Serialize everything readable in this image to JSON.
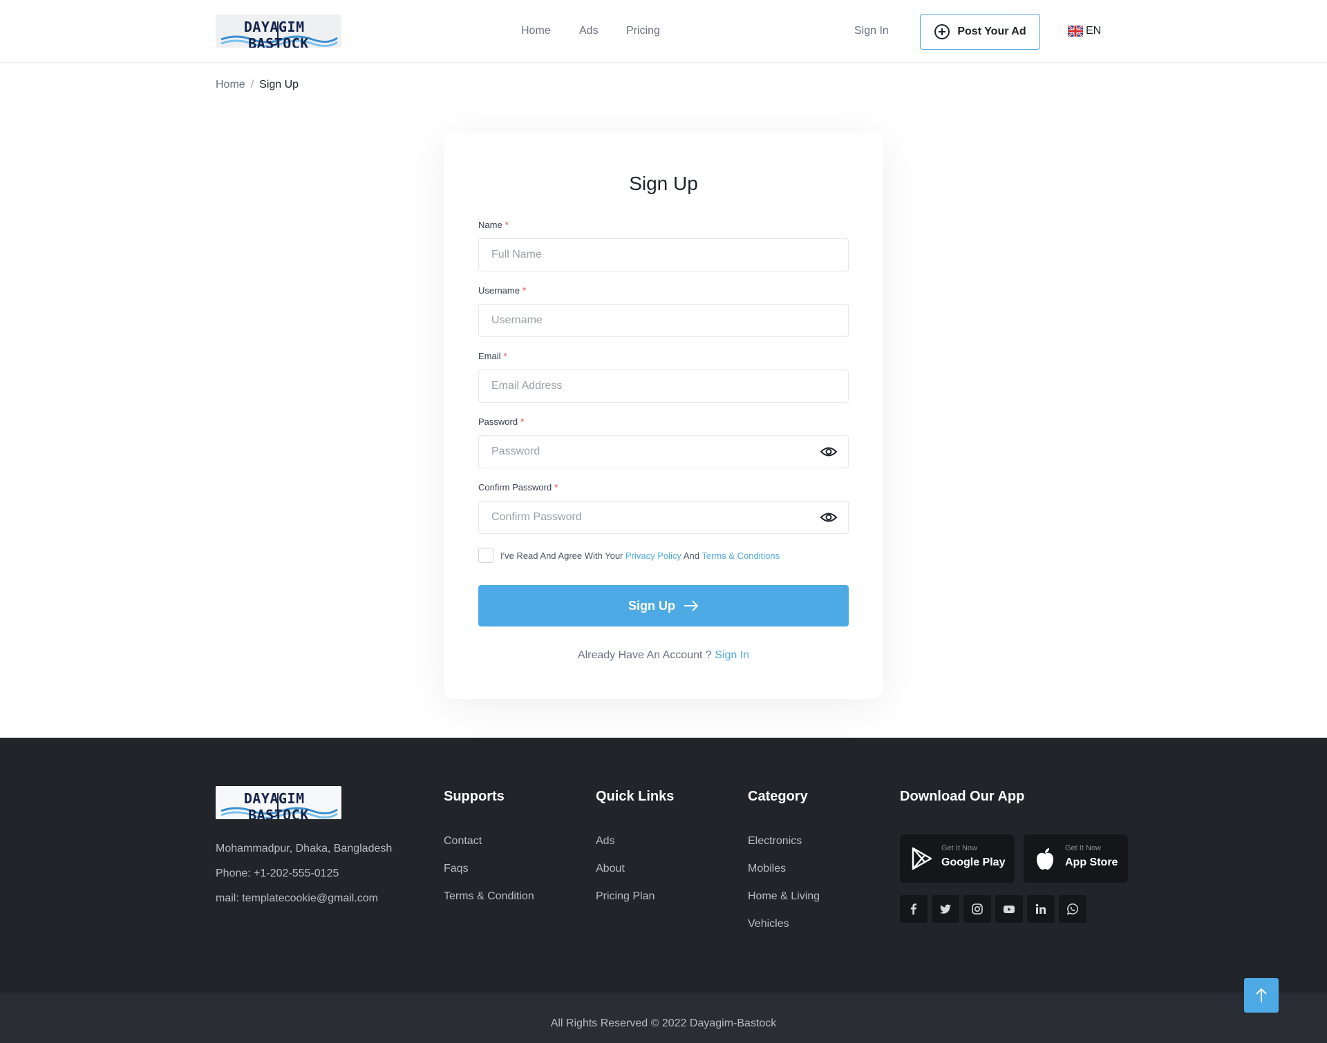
{
  "brand": {
    "logo_text": "DAYAGIM BASTOCK"
  },
  "nav": {
    "home": "Home",
    "ads": "Ads",
    "pricing": "Pricing"
  },
  "header": {
    "sign_in": "Sign In",
    "post_ad": "Post Your Ad",
    "language": "EN"
  },
  "breadcrumb": {
    "home": "Home",
    "separator": "/",
    "current": "Sign Up"
  },
  "form": {
    "title": "Sign Up",
    "required_mark": "*",
    "name": {
      "label": "Name",
      "placeholder": "Full Name"
    },
    "username": {
      "label": "Username",
      "placeholder": "Username"
    },
    "email": {
      "label": "Email",
      "placeholder": "Email Address"
    },
    "password": {
      "label": "Password",
      "placeholder": "Password"
    },
    "confirm_password": {
      "label": "Confirm Password",
      "placeholder": "Confirm Password"
    },
    "agree": {
      "prefix": "I've Read And Agree With Your",
      "privacy": "Privacy Policy",
      "and": "And",
      "terms": "Terms & Conditions"
    },
    "submit": "Sign Up",
    "already_text": "Already Have An Account ?",
    "sign_in_link": "Sign In"
  },
  "footer": {
    "address": "Mohammadpur, Dhaka, Bangladesh",
    "phone": "Phone: +1-202-555-0125",
    "mail": "mail: templatecookie@gmail.com",
    "supports": {
      "title": "Supports",
      "links": [
        "Contact",
        "Faqs",
        "Terms & Condition"
      ]
    },
    "quick_links": {
      "title": "Quick Links",
      "links": [
        "Ads",
        "About",
        "Pricing Plan"
      ]
    },
    "category": {
      "title": "Category",
      "links": [
        "Electronics",
        "Mobiles",
        "Home & Living",
        "Vehicles"
      ]
    },
    "download": {
      "title": "Download Our App",
      "google": {
        "small": "Get It Now",
        "big": "Google Play"
      },
      "apple": {
        "small": "Get It Now",
        "big": "App Store"
      }
    },
    "social_icons": [
      "facebook-icon",
      "twitter-icon",
      "instagram-icon",
      "youtube-icon",
      "linkedin-icon",
      "whatsapp-icon"
    ],
    "copyright": "All Rights Reserved © 2022 Dayagim-Bastock"
  },
  "colors": {
    "accent": "#4eaae5",
    "footer_bg": "#212429",
    "required": "#e0463b"
  }
}
